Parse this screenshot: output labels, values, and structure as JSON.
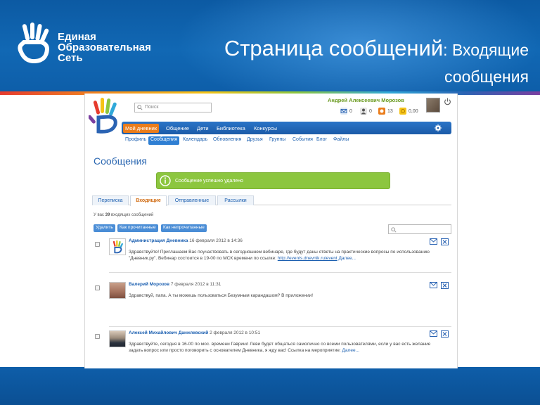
{
  "slide": {
    "brand_lines": [
      "Единая",
      "Образовательная",
      "Сеть"
    ],
    "title_big": "Страница сообщений",
    "title_small_1": ": Входящие",
    "title_small_2": "сообщения"
  },
  "app": {
    "search_placeholder": "Поиск",
    "user_name": "Андрей Алексеевич Морозов",
    "counters": [
      {
        "icon": "envelope-icon",
        "value": "0"
      },
      {
        "icon": "user-icon",
        "value": "0"
      },
      {
        "icon": "badge-icon",
        "value": "13"
      },
      {
        "icon": "coin-icon",
        "value": "0,00"
      }
    ],
    "main_nav": [
      "Мой дневник",
      "Общение",
      "Дети",
      "Библиотека",
      "Конкурсы"
    ],
    "main_nav_active": 0,
    "sub_nav": [
      "Профиль",
      "Сообщения",
      "Календарь",
      "Обновления",
      "Друзья",
      "Группы",
      "События",
      "Блог",
      "Файлы"
    ],
    "sub_nav_active": 1,
    "page_heading": "Сообщения",
    "success_message": "Сообщение успешно удалено",
    "tabs": [
      "Переписка",
      "Входящие",
      "Отправленные",
      "Рассылки"
    ],
    "tabs_active": 1,
    "count_prefix": "У вас ",
    "count_number": "39",
    "count_suffix": " входящих сообщений",
    "actions": [
      "Удалить",
      "Как прочитанные",
      "Как непрочитанные"
    ],
    "messages": [
      {
        "author": "Администрация Дневника",
        "date": "16 февраля 2012 в 14:36",
        "text": "Здравствуйте! Приглашаем Вас поучаствовать в сегодняшнем вебинаре, где будут даны ответы на практические вопросы по использованию \"Дневник.ру\". Вебинар состоится в 19-00 по МСК времени по ссылке: ",
        "link": "http://events.dnevnik.ru/event",
        "more": " Далее..."
      },
      {
        "author": "Валерий Морозов",
        "date": "7 февраля 2012 в 11:31",
        "text": "Здравствуй, папа. А ты можешь пользоваться Безумным карандашом? В приложении!",
        "link": "",
        "more": ""
      },
      {
        "author": "Алексей Михайлович Данилевский",
        "date": "2 февраля 2012 в 10:51",
        "text": "Здравствуйте, сегодня в 16-00 по мос. времени Гавриил Леви будет общаться самолично со всеми пользователями, если у вас есть желание задать вопрос или просто поговорить с основателем Дневника, я жду вас! Ссылка на мероприятие: ",
        "link": "",
        "more": "Далее..."
      }
    ]
  },
  "colors": {
    "header_blue": "#1168b4",
    "nav_blue": "#1c5ba8",
    "active_orange": "#ea7d1c",
    "success_green": "#8cc63f",
    "link_blue": "#1b5fb0"
  }
}
